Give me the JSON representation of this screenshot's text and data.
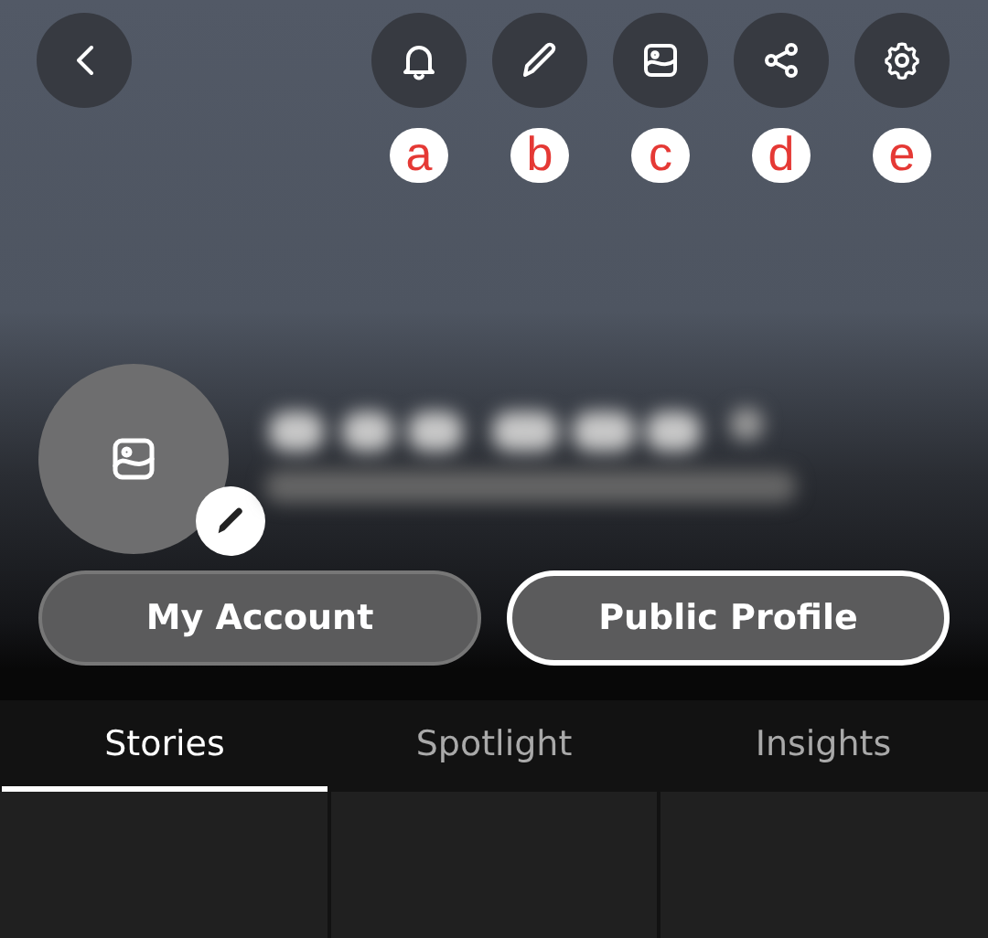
{
  "header": {
    "actions": [
      {
        "annotation": "a"
      },
      {
        "annotation": "b"
      },
      {
        "annotation": "c"
      },
      {
        "annotation": "d"
      },
      {
        "annotation": "e"
      }
    ]
  },
  "profile": {
    "avatar": {
      "edit_badge": true
    }
  },
  "buttons": [
    {
      "label": "My Account",
      "outlined": false
    },
    {
      "label": "Public Profile",
      "outlined": true
    }
  ],
  "tabs": [
    {
      "label": "Stories",
      "selected": true
    },
    {
      "label": "Spotlight",
      "selected": false
    },
    {
      "label": "Insights",
      "selected": false
    }
  ],
  "tiles": [
    {
      "kind": "empty"
    },
    {
      "kind": "empty"
    },
    {
      "kind": "empty"
    }
  ]
}
